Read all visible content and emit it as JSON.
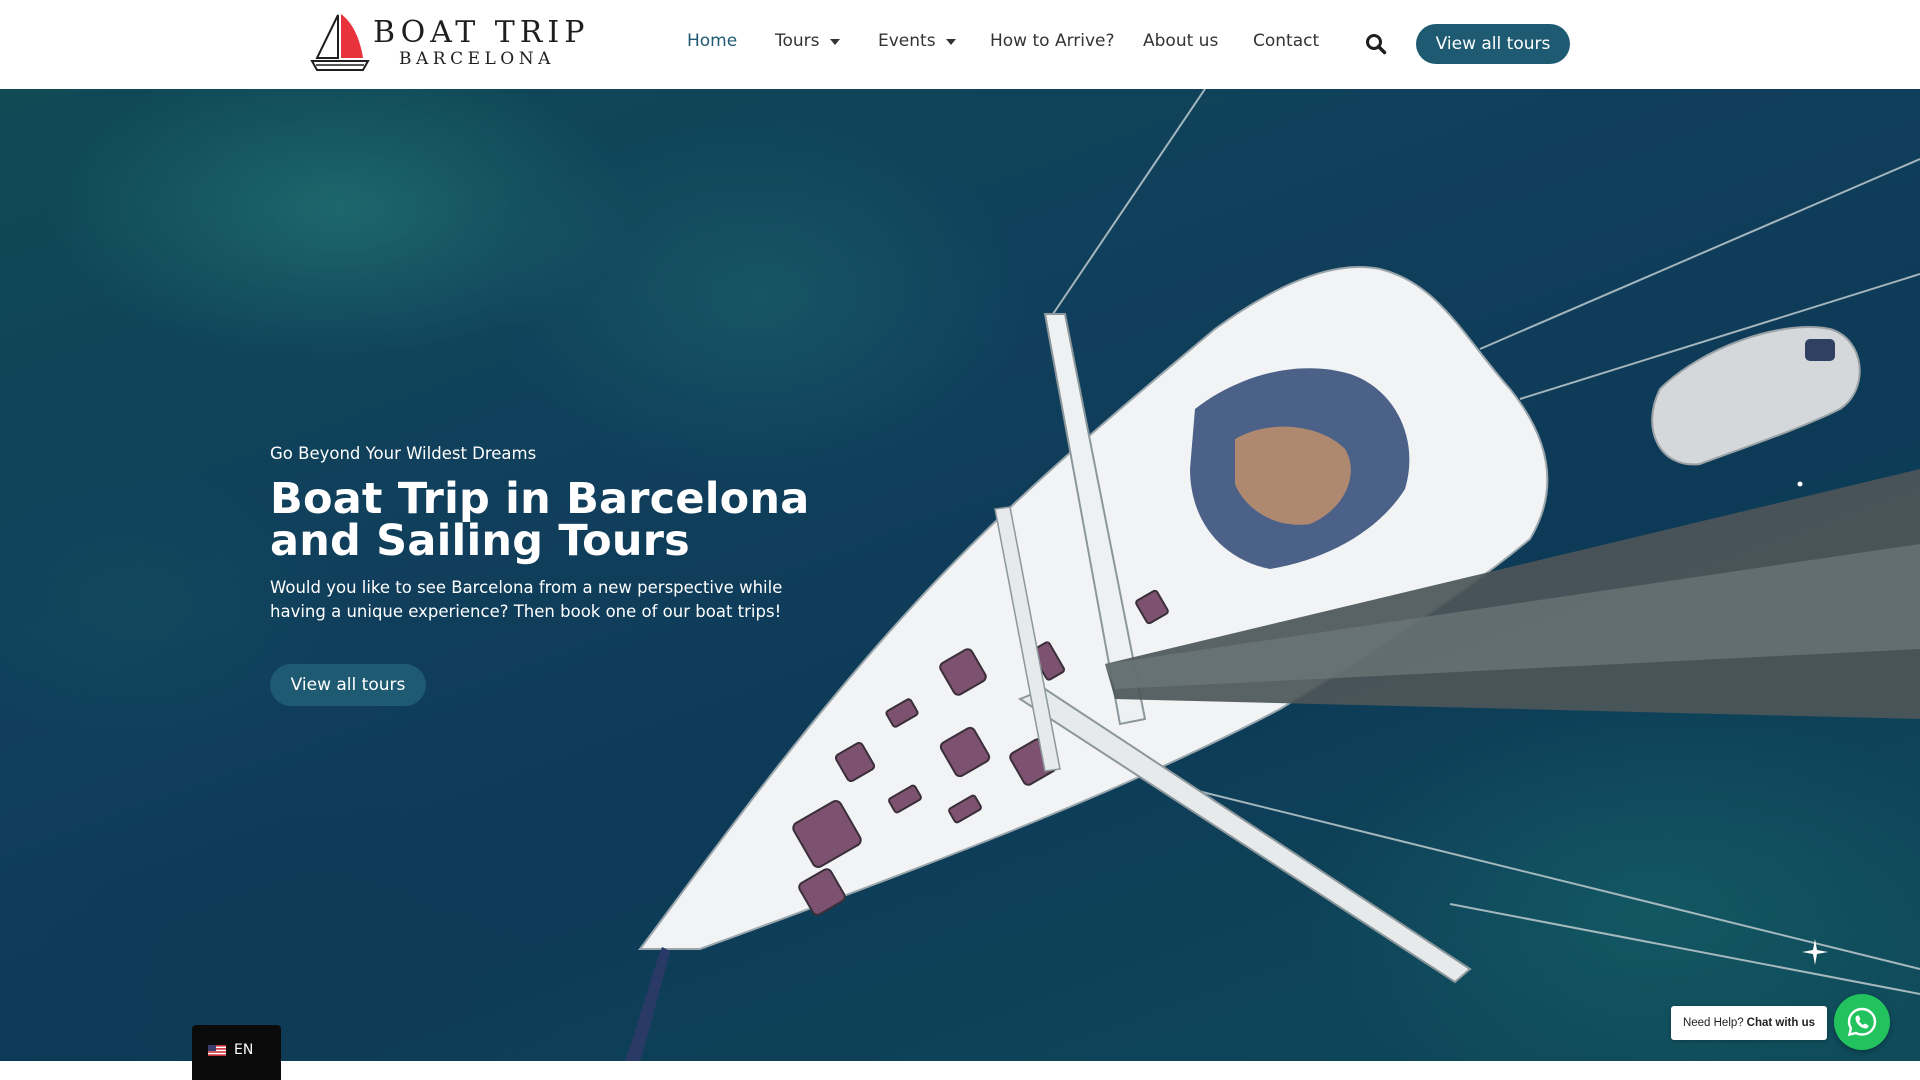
{
  "header": {
    "logo": {
      "line1": "BOAT TRIP",
      "line2": "BARCELONA"
    },
    "nav": [
      {
        "label": "Home",
        "active": true
      },
      {
        "label": "Tours",
        "dropdown": true
      },
      {
        "label": "Events",
        "dropdown": true
      },
      {
        "label": "How to Arrive?"
      },
      {
        "label": "About us"
      },
      {
        "label": "Contact"
      }
    ],
    "search_icon": "search-icon",
    "cta_label": "View all tours"
  },
  "hero": {
    "tagline": "Go Beyond Your Wildest Dreams",
    "title": "Boat Trip in Barcelona and Sailing Tours",
    "description": "Would you like to see Barcelona from a new perspective while having a unique experience? Then book one of our boat trips!",
    "button_label": "View all tours"
  },
  "language": {
    "code": "EN",
    "flag_icon": "us-flag-icon"
  },
  "chat": {
    "prefix": "Need Help?",
    "action": "Chat with us",
    "icon": "whatsapp-icon"
  },
  "colors": {
    "brand": "#1e5b72",
    "logo_red": "#e8323c",
    "whatsapp": "#22c35e"
  }
}
